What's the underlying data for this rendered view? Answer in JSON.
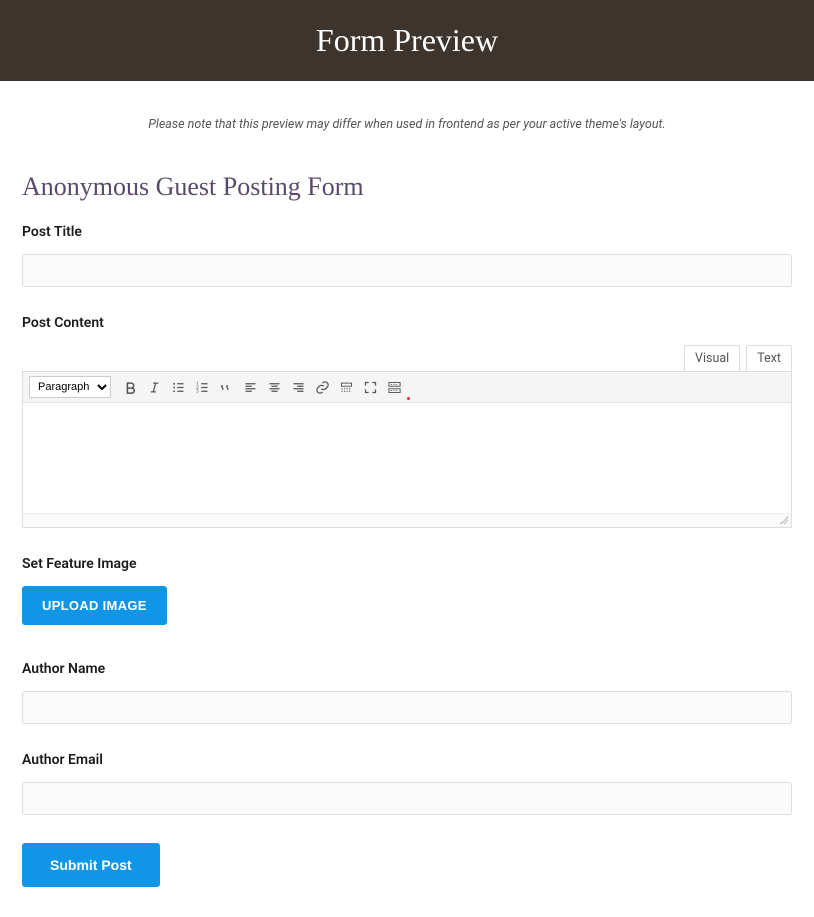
{
  "header": {
    "title": "Form Preview"
  },
  "note": "Please note that this preview may differ when used in frontend as per your active theme's layout.",
  "form": {
    "title": "Anonymous Guest Posting Form",
    "fields": {
      "post_title": {
        "label": "Post Title",
        "value": ""
      },
      "post_content": {
        "label": "Post Content",
        "value": ""
      },
      "feature_image": {
        "label": "Set Feature Image",
        "button": "UPLOAD IMAGE"
      },
      "author_name": {
        "label": "Author Name",
        "value": ""
      },
      "author_email": {
        "label": "Author Email",
        "value": ""
      }
    },
    "submit_label": "Submit Post"
  },
  "editor": {
    "tabs": {
      "visual": "Visual",
      "text": "Text"
    },
    "format_select": "Paragraph"
  }
}
